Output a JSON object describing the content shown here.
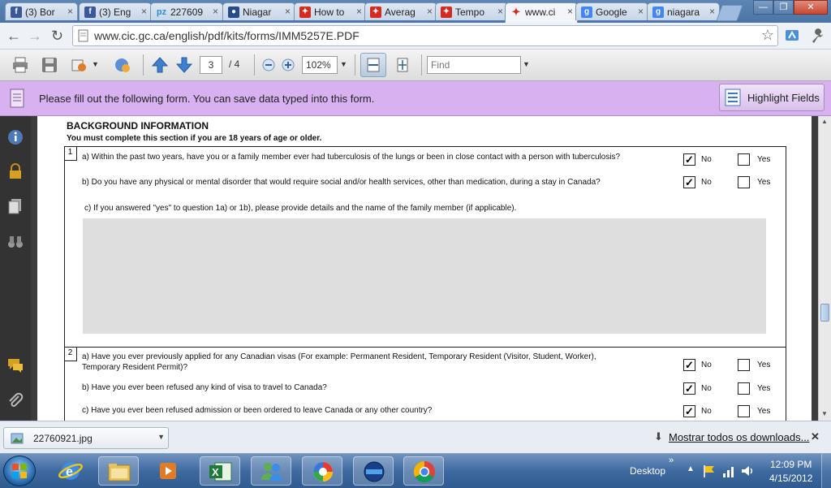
{
  "browser": {
    "tabs": [
      {
        "title": "(3) Bor",
        "favicon": "facebook-icon",
        "color": "#3b5998"
      },
      {
        "title": "(3) Eng",
        "favicon": "facebook-icon",
        "color": "#3b5998"
      },
      {
        "title": "227609",
        "favicon": "pz-icon",
        "color": "#2d8fd6"
      },
      {
        "title": "Niagar",
        "favicon": "badge-icon",
        "color": "#274b86"
      },
      {
        "title": "How to",
        "favicon": "canada-flag-icon",
        "color": "#d52b1e"
      },
      {
        "title": "Averag",
        "favicon": "canada-flag-icon",
        "color": "#d52b1e"
      },
      {
        "title": "Tempo",
        "favicon": "canada-flag-icon",
        "color": "#d52b1e"
      },
      {
        "title": "www.ci",
        "favicon": "maple-leaf-icon",
        "color": "#d52b1e",
        "active": true
      },
      {
        "title": "Google",
        "favicon": "google-icon",
        "color": "#4285f4"
      },
      {
        "title": "niagara",
        "favicon": "google-icon",
        "color": "#4285f4"
      }
    ],
    "url": "www.cic.gc.ca/english/pdf/kits/forms/IMM5257E.PDF"
  },
  "pdf_toolbar": {
    "page_current": "3",
    "page_total": "/ 4",
    "zoom": "102%",
    "find_placeholder": "Find"
  },
  "message_bar": {
    "text": "Please fill out the following form. You can save data typed into this form.",
    "highlight_label": "Highlight Fields"
  },
  "form": {
    "heading": "BACKGROUND INFORMATION",
    "subheading": "You must complete this section if you are 18 years of age or older.",
    "section1": {
      "number": "1",
      "q_a": "a) Within the past two years, have you or a family member ever had tuberculosis of the lungs or been in close contact with a person with tuberculosis?",
      "q_b": "b) Do you have any physical or mental disorder that would require social and/or health services, other than medication, during a stay in Canada?",
      "q_c": "c) If you answered \"yes\" to question 1a) or 1b), please provide details and the name of the family member (if applicable)."
    },
    "section2": {
      "number": "2",
      "q_a1": "a) Have you ever previously applied for any Canadian visas (For example: Permanent Resident, Temporary Resident (Visitor, Student, Worker),",
      "q_a2": "Temporary Resident Permit)?",
      "q_b": "b) Have you ever been refused any kind of visa to travel to Canada?",
      "q_c": "c) Have you ever been refused admission or been ordered to leave Canada or any other country?"
    },
    "no_label": "No",
    "yes_label": "Yes",
    "check_mark": "✓"
  },
  "downloads": {
    "file": "22760921.jpg",
    "show_all": "Mostrar todos os downloads...",
    "close": "✕"
  },
  "taskbar": {
    "desktop_label": "Desktop",
    "time": "12:09 PM",
    "date": "4/15/2012"
  }
}
